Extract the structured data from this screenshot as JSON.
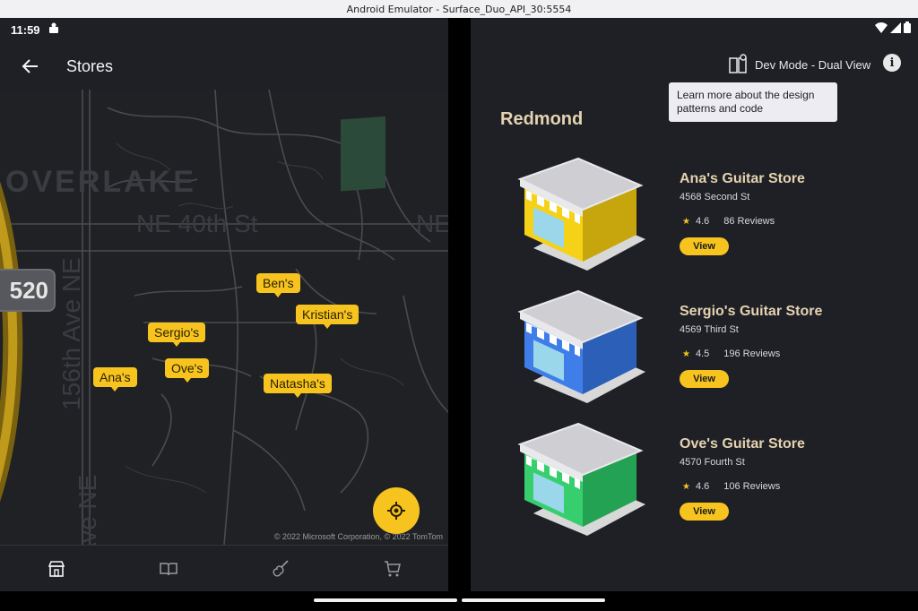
{
  "window": {
    "title": "Android Emulator - Surface_Duo_API_30:5554"
  },
  "status_bar": {
    "time": "11:59"
  },
  "left_pane": {
    "title": "Stores",
    "map": {
      "area_label": "OVERLAKE",
      "street_label": "NE 40th St",
      "street_label_2": "NE",
      "avenue_label": "156th Ave NE",
      "avenue_label_2": "Ave NE",
      "highway_shield": "520",
      "copyright": "© 2022 Microsoft Corporation, © 2022 TomTom",
      "pins": [
        "Ben's",
        "Kristian's",
        "Sergio's",
        "Ove's",
        "Ana's",
        "Natasha's"
      ]
    },
    "nav": [
      "store-icon",
      "book-icon",
      "guitar-icon",
      "cart-icon"
    ]
  },
  "right_pane": {
    "dev_mode_label": "Dev Mode - Dual View",
    "tooltip": "Learn more about the design patterns and code",
    "city": "Redmond",
    "stores": [
      {
        "name": "Ana's Guitar Store",
        "address": "4568 Second St",
        "rating": "4.6",
        "reviews": "86 Reviews",
        "view_label": "View",
        "color": "#f5d218",
        "color_dark": "#c7a50d"
      },
      {
        "name": "Sergio's Guitar Store",
        "address": "4569 Third St",
        "rating": "4.5",
        "reviews": "196 Reviews",
        "view_label": "View",
        "color": "#3f7ee9",
        "color_dark": "#2c5fb8"
      },
      {
        "name": "Ove's Guitar Store",
        "address": "4570 Fourth St",
        "rating": "4.6",
        "reviews": "106 Reviews",
        "view_label": "View",
        "color": "#37cf6e",
        "color_dark": "#24a253"
      }
    ]
  },
  "colors": {
    "accent": "#f7c41f",
    "background": "#1f2026",
    "heading": "#e5d3b0"
  }
}
